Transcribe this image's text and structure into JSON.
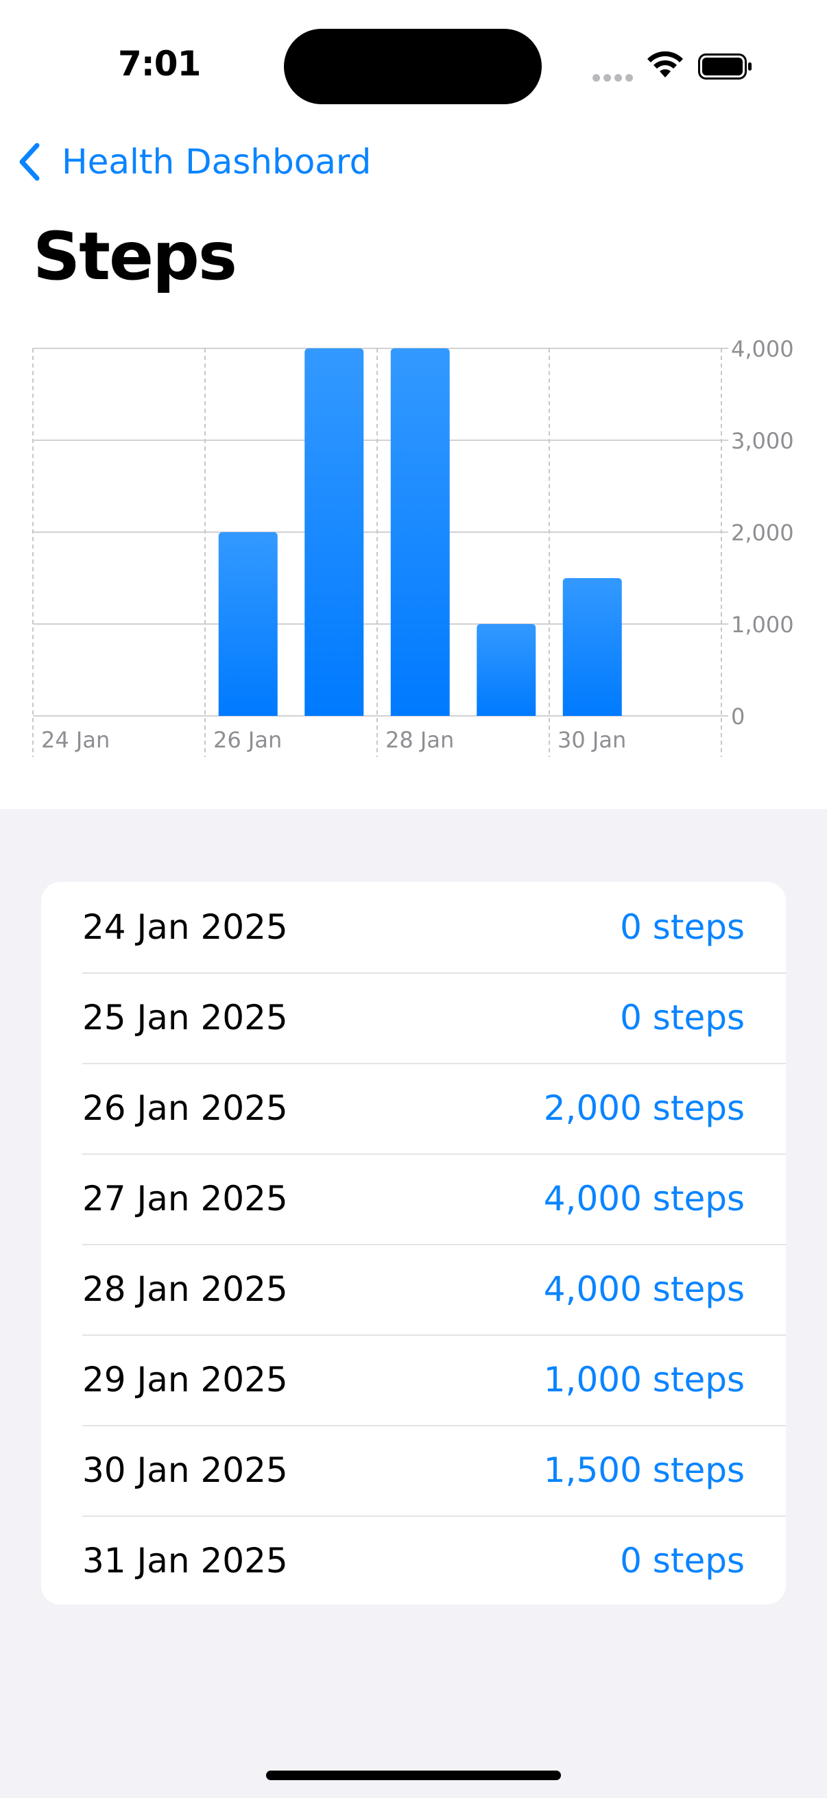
{
  "status_bar": {
    "time": "7:01"
  },
  "nav": {
    "back_label": "Health Dashboard"
  },
  "page": {
    "title": "Steps"
  },
  "chart_data": {
    "type": "bar",
    "categories": [
      "24 Jan",
      "25 Jan",
      "26 Jan",
      "27 Jan",
      "28 Jan",
      "29 Jan",
      "30 Jan",
      "31 Jan"
    ],
    "values": [
      0,
      0,
      2000,
      4000,
      4000,
      1000,
      1500,
      0
    ],
    "x_tick_labels": [
      "24 Jan",
      "26 Jan",
      "28 Jan",
      "30 Jan"
    ],
    "y_ticks": [
      0,
      1000,
      2000,
      3000,
      4000
    ],
    "y_tick_labels": [
      "0",
      "1,000",
      "2,000",
      "3,000",
      "4,000"
    ],
    "ylim": [
      0,
      4000
    ],
    "grid": true,
    "y_axis_side": "right",
    "bar_color_top": "#3399ff",
    "bar_color_bottom": "#007aff"
  },
  "list": {
    "rows": [
      {
        "date": "24 Jan 2025",
        "value": "0 steps"
      },
      {
        "date": "25 Jan 2025",
        "value": "0 steps"
      },
      {
        "date": "26 Jan 2025",
        "value": "2,000 steps"
      },
      {
        "date": "27 Jan 2025",
        "value": "4,000 steps"
      },
      {
        "date": "28 Jan 2025",
        "value": "4,000 steps"
      },
      {
        "date": "29 Jan 2025",
        "value": "1,000 steps"
      },
      {
        "date": "30 Jan 2025",
        "value": "1,500 steps"
      },
      {
        "date": "31 Jan 2025",
        "value": "0 steps"
      }
    ]
  },
  "colors": {
    "accent": "#0a84ff",
    "background": "#f2f2f7"
  }
}
